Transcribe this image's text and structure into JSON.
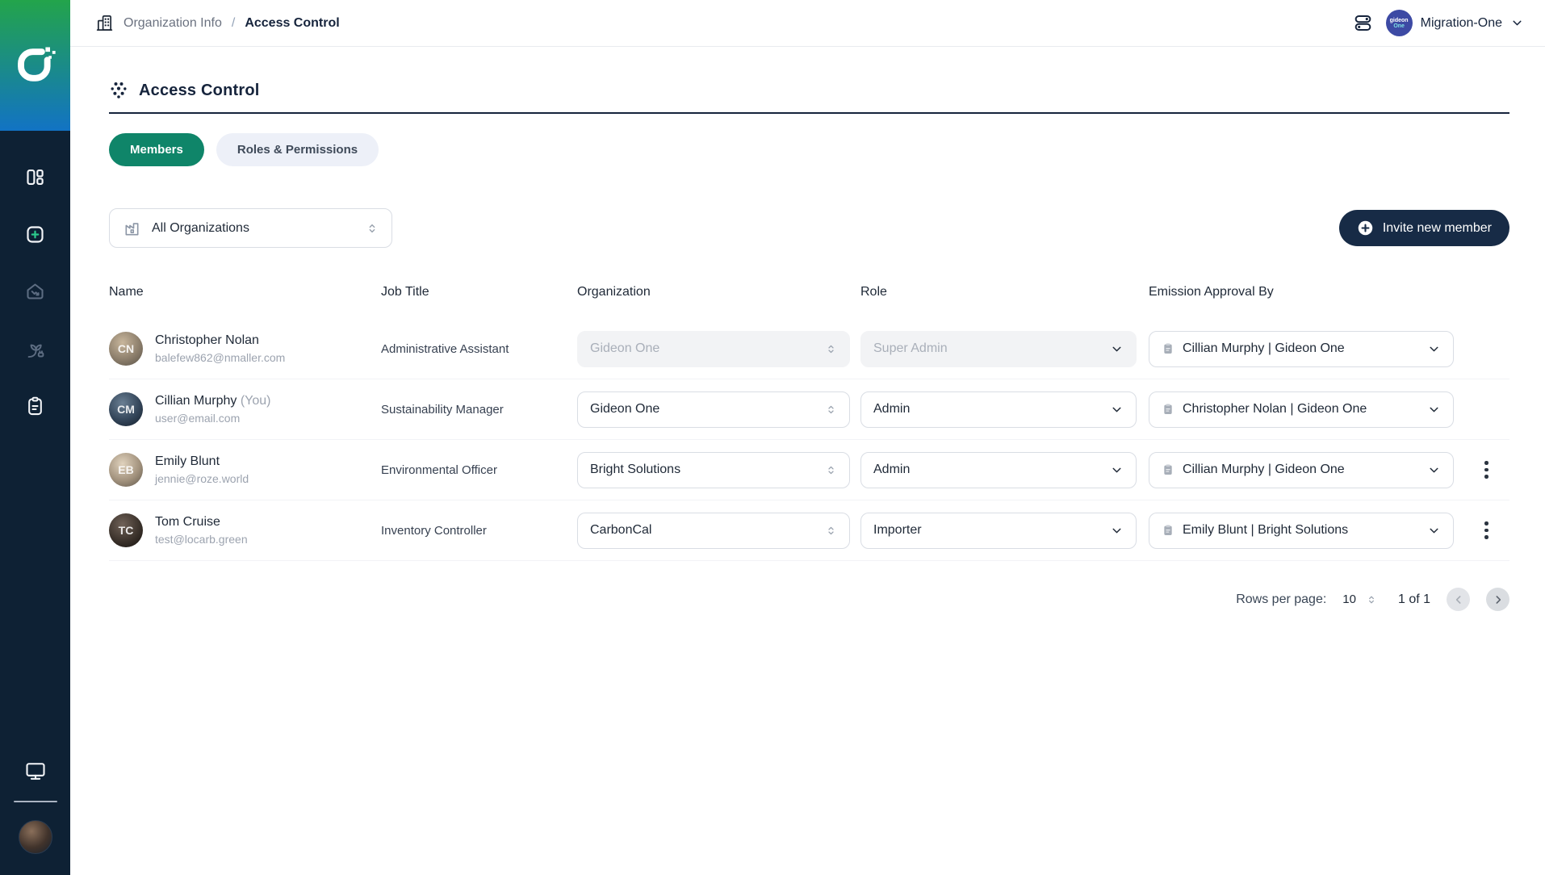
{
  "topbar": {
    "breadcrumb": {
      "section": "Organization Info",
      "separator": "/",
      "current": "Access Control"
    },
    "org_switcher": {
      "label": "Migration-One",
      "avatar_line1": "gideon",
      "avatar_line2": "One"
    }
  },
  "sidebar": {
    "items": [
      {
        "icon": "layout-dashboard-icon"
      },
      {
        "icon": "square-plus-icon"
      },
      {
        "icon": "house-activity-icon"
      },
      {
        "icon": "plant-energy-icon"
      },
      {
        "icon": "clipboard-icon"
      }
    ],
    "bottom_items": [
      {
        "icon": "monitor-icon"
      },
      {
        "icon": "user-avatar"
      }
    ]
  },
  "main": {
    "title": "Access Control",
    "tabs": [
      {
        "label": "Members",
        "active": true
      },
      {
        "label": "Roles & Permissions",
        "active": false
      }
    ],
    "filter": {
      "label": "All Organizations"
    },
    "invite_button_label": "Invite new member"
  },
  "table": {
    "columns": [
      "Name",
      "Job Title",
      "Organization",
      "Role",
      "Emission Approval By"
    ],
    "rows": [
      {
        "name": "Christopher Nolan",
        "you": "",
        "initials": "CN",
        "email": "balefew862@nmaller.com",
        "job_title": "Administrative Assistant",
        "organization": "Gideon One",
        "org_disabled": true,
        "role": "Super Admin",
        "role_disabled": true,
        "approver": "Cillian Murphy | Gideon One",
        "menu": false
      },
      {
        "name": "Cillian Murphy",
        "you": "(You)",
        "initials": "CM",
        "email": "user@email.com",
        "job_title": "Sustainability Manager",
        "organization": "Gideon One",
        "org_disabled": false,
        "role": "Admin",
        "role_disabled": false,
        "approver": "Christopher Nolan | Gideon One",
        "menu": false
      },
      {
        "name": "Emily Blunt",
        "you": "",
        "initials": "EB",
        "email": "jennie@roze.world",
        "job_title": "Environmental Officer",
        "organization": "Bright Solutions",
        "org_disabled": false,
        "role": "Admin",
        "role_disabled": false,
        "approver": "Cillian Murphy | Gideon One",
        "menu": true
      },
      {
        "name": "Tom Cruise",
        "you": "",
        "initials": "TC",
        "email": "test@locarb.green",
        "job_title": "Inventory Controller",
        "organization": "CarbonCal",
        "org_disabled": false,
        "role": "Importer",
        "role_disabled": false,
        "approver": "Emily Blunt | Bright Solutions",
        "menu": true
      }
    ]
  },
  "pagination": {
    "rows_per_page_label": "Rows per page:",
    "rows_per_page_value": "10",
    "page_info": "1 of 1"
  },
  "colors": {
    "sidebar_navy": "#0E2134",
    "accent_green": "#0F8569",
    "logo_gradient_top": "#23A44B",
    "logo_gradient_bottom": "#1273C4",
    "invite_navy": "#172B46",
    "org_avatar_indigo": "#3D4AA4"
  }
}
